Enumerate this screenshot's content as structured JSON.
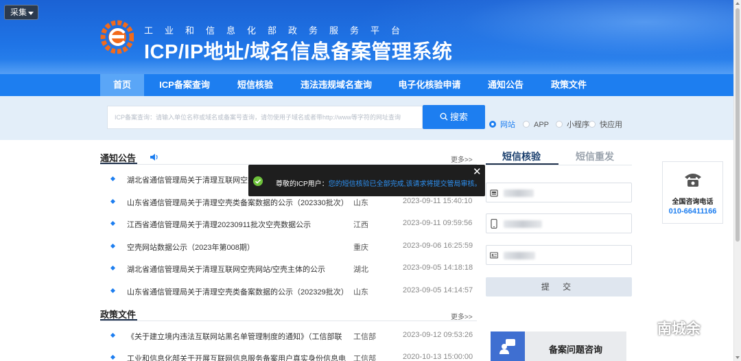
{
  "toolbar": {
    "collect_label": "采集"
  },
  "header": {
    "subtitle": "工业和信息化部政务服务平台",
    "title": "ICP/IP地址/域名信息备案管理系统"
  },
  "nav": {
    "items": [
      {
        "label": "首页",
        "active": true
      },
      {
        "label": "ICP备案查询"
      },
      {
        "label": "短信核验"
      },
      {
        "label": "违法违规域名查询"
      },
      {
        "label": "电子化核验申请"
      },
      {
        "label": "通知公告"
      },
      {
        "label": "政策文件"
      }
    ]
  },
  "search": {
    "placeholder": "ICP备案查询：请输入单位名称或域名或备案号查询，请勿使用子域名或者带http://www等字符的网址查询",
    "button_label": "搜索",
    "types": [
      {
        "label": "网站",
        "selected": true
      },
      {
        "label": "APP"
      },
      {
        "label": "小程序"
      },
      {
        "label": "快应用"
      }
    ]
  },
  "notices": {
    "title": "通知公告",
    "more": "更多>>",
    "rows": [
      {
        "title": "湖北省通信管理局关于清理互联网空完网",
        "province": "",
        "date": ""
      },
      {
        "title": "山东省通信管理局关于清理空壳类备案数据的公示（202330批次）",
        "province": "山东",
        "date": "2023-09-11 15:40:10"
      },
      {
        "title": "江西省通信管理局关于清理20230911批次空壳数据公示",
        "province": "江西",
        "date": "2023-09-11 09:59:56"
      },
      {
        "title": "空壳网站数据公示（2023年第008期）",
        "province": "重庆",
        "date": "2023-09-06 16:25:59"
      },
      {
        "title": "湖北省通信管理局关于清理互联网空壳网站/空壳主体的公示",
        "province": "湖北",
        "date": "2023-09-05 14:18:18"
      },
      {
        "title": "山东省通信管理局关于清理空壳类备案数据的公示（202329批次）",
        "province": "山东",
        "date": "2023-09-05 14:14:57"
      }
    ]
  },
  "policies": {
    "title": "政策文件",
    "more": "更多>>",
    "rows": [
      {
        "title": "《关于建立境内违法互联网站黑名单管理制度的通知》（工信部联",
        "province": "工信部",
        "date": "2023-09-12 09:53:26"
      },
      {
        "title": "工业和信息化部关于开展互联网信息服务备案用户真实身份信息电",
        "province": "工信部",
        "date": "2020-10-13 15:00:00"
      }
    ]
  },
  "sms": {
    "tab_active": "短信核验",
    "tab_inactive": "短信重发",
    "submit_label": "提  交"
  },
  "hotline": {
    "label": "全国咨询电话",
    "number": "010-66411166"
  },
  "consult": {
    "label": "备案问题咨询"
  },
  "toast": {
    "prefix": "尊敬的ICP用户：",
    "message": "您的短信核验已全部完成,该请求将提交管局审核。",
    "close": "✕"
  },
  "watermark": {
    "text": "南城余"
  },
  "colors": {
    "primary": "#1d7ef0",
    "banner": "#1f74e6",
    "toast_bg": "#1e1e1e",
    "success": "#6ec23b"
  }
}
